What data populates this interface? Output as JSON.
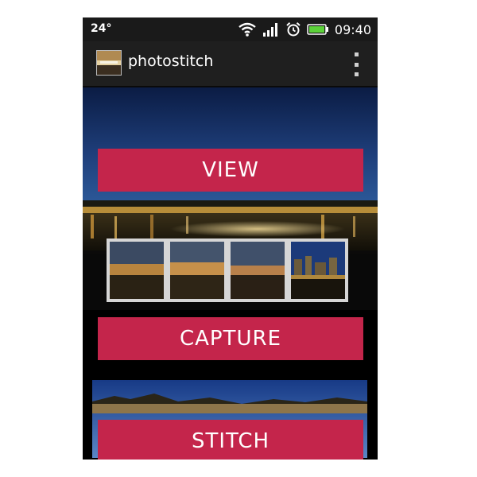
{
  "status_bar": {
    "temperature": "24°",
    "time": "09:40",
    "icons": [
      "wifi-icon",
      "signal-icon",
      "alarm-icon",
      "battery-icon"
    ]
  },
  "action_bar": {
    "title": "photostitch",
    "app_icon": "app-icon",
    "menu_icon": "overflow-menu-icon"
  },
  "buttons": {
    "view": "VIEW",
    "capture": "CAPTURE",
    "stitch": "STITCH"
  },
  "colors": {
    "button": "#c4254b",
    "status_bar": "#1a1a1a",
    "action_bar": "#1f1f1f",
    "battery": "#5cd23a"
  }
}
